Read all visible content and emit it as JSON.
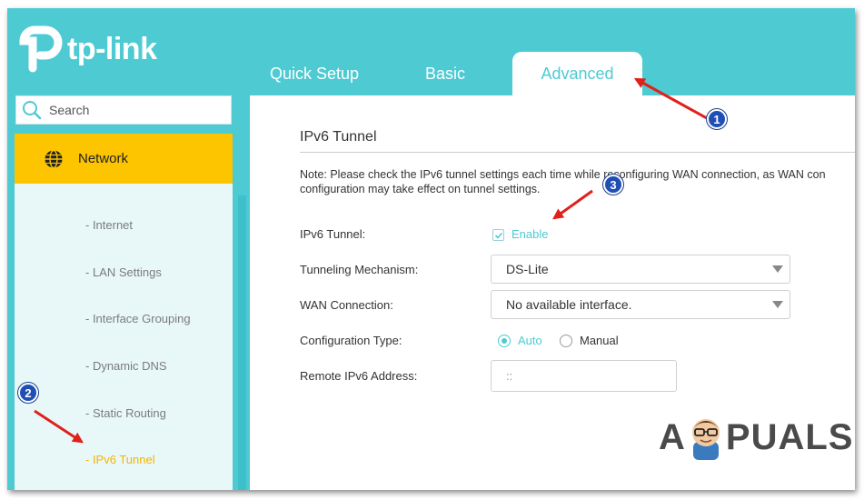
{
  "logo": {
    "brand": "tp-link"
  },
  "tabs": [
    {
      "label": "Quick Setup"
    },
    {
      "label": "Basic"
    },
    {
      "label": "Advanced",
      "active": true
    }
  ],
  "search": {
    "placeholder": "Search",
    "icon": "search-icon"
  },
  "sidebar": {
    "section": {
      "label": "Network",
      "icon": "globe-icon"
    },
    "items": [
      {
        "label": "- Internet"
      },
      {
        "label": "- LAN Settings"
      },
      {
        "label": "- Interface Grouping"
      },
      {
        "label": "- Dynamic DNS"
      },
      {
        "label": "- Static Routing"
      },
      {
        "label": "- IPv6 Tunnel",
        "active": true
      }
    ]
  },
  "main": {
    "title": "IPv6 Tunnel",
    "note_line1": "Note: Please check the IPv6 tunnel settings each time while reconfiguring WAN connection, as WAN con",
    "note_line2": "configuration may take effect on tunnel settings.",
    "ipv6_tunnel": {
      "label": "IPv6 Tunnel:",
      "checkbox_label": "Enable",
      "checked": true
    },
    "mechanism": {
      "label": "Tunneling Mechanism:",
      "value": "DS-Lite"
    },
    "wan_connection": {
      "label": "WAN Connection:",
      "value": "No available interface."
    },
    "config_type": {
      "label": "Configuration Type:",
      "options": [
        "Auto",
        "Manual"
      ],
      "selected": "Auto"
    },
    "remote_address": {
      "label": "Remote IPv6 Address:",
      "value": "::"
    }
  },
  "annotations": [
    {
      "number": "1"
    },
    {
      "number": "2"
    },
    {
      "number": "3"
    }
  ],
  "watermark": {
    "before": "A",
    "after": "PUALS"
  },
  "colors": {
    "teal": "#4ecad3",
    "yellow": "#fdc400",
    "arrow": "#e0211b",
    "badge": "#1f4fb5"
  }
}
